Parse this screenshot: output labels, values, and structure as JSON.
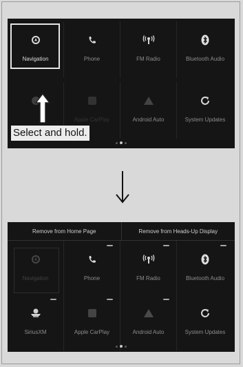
{
  "top_screen": {
    "tiles": [
      {
        "label": "Navigation",
        "icon": "navigation-icon"
      },
      {
        "label": "Phone",
        "icon": "phone-icon"
      },
      {
        "label": "FM Radio",
        "icon": "radio-icon"
      },
      {
        "label": "Bluetooth Audio",
        "icon": "bluetooth-icon"
      },
      {
        "label": "",
        "icon": "siriusxm-icon"
      },
      {
        "label": "Apple CarPlay",
        "icon": "carplay-icon"
      },
      {
        "label": "Android Auto",
        "icon": "android-auto-icon"
      },
      {
        "label": "System Updates",
        "icon": "system-updates-icon"
      }
    ],
    "callout": "Select and hold."
  },
  "bottom_screen": {
    "options": [
      "Remove from Home Page",
      "Remove from Heads-Up Display"
    ],
    "tiles": [
      {
        "label": "Navigation",
        "icon": "navigation-icon"
      },
      {
        "label": "Phone",
        "icon": "phone-icon"
      },
      {
        "label": "FM Radio",
        "icon": "radio-icon"
      },
      {
        "label": "Bluetooth Audio",
        "icon": "bluetooth-icon"
      },
      {
        "label": "SiriusXM",
        "icon": "siriusxm-icon"
      },
      {
        "label": "Apple CarPlay",
        "icon": "carplay-icon"
      },
      {
        "label": "Android Auto",
        "icon": "android-auto-icon"
      },
      {
        "label": "System Updates",
        "icon": "system-updates-icon"
      }
    ]
  },
  "colors": {
    "screen_bg": "#151515",
    "page_bg": "#d9d9d9",
    "callout_bg": "#ececec"
  }
}
